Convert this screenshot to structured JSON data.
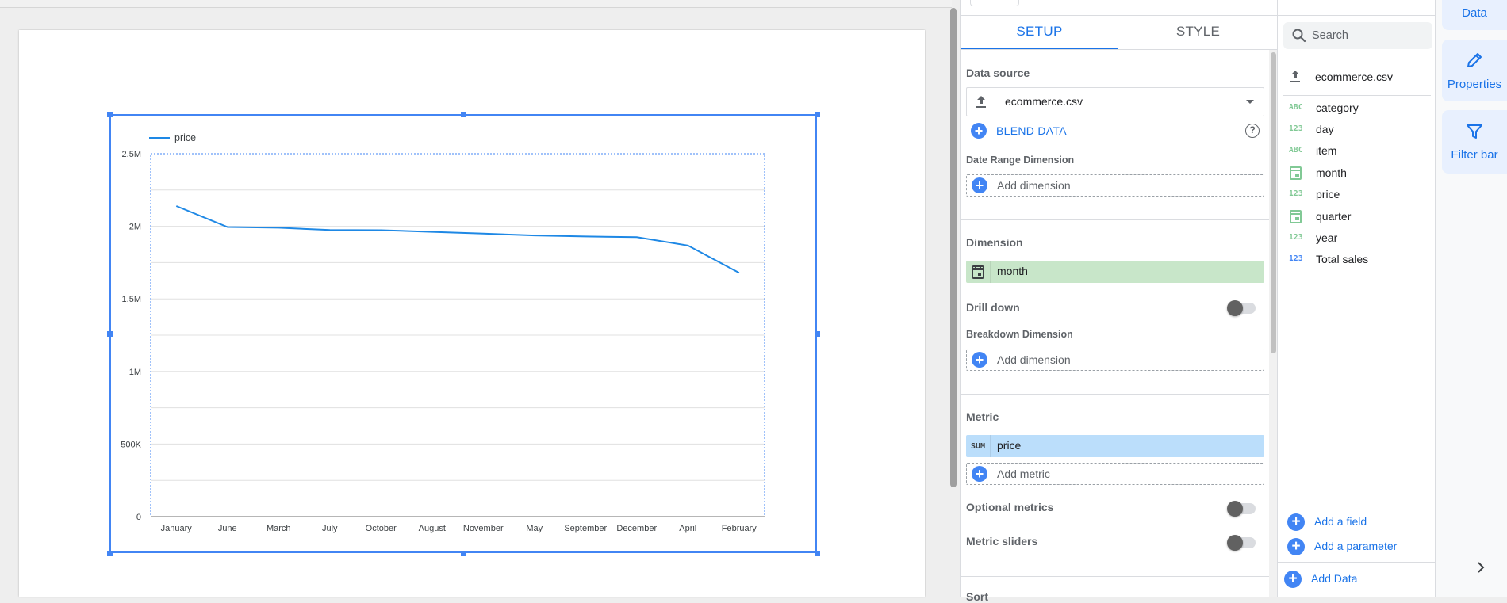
{
  "chart": {
    "legend": "price",
    "line_color": "#1e88e5",
    "chart_data": {
      "type": "line",
      "categories": [
        "January",
        "June",
        "March",
        "July",
        "October",
        "August",
        "November",
        "May",
        "September",
        "December",
        "April",
        "February"
      ],
      "series": [
        {
          "name": "price",
          "values": [
            2140000,
            1995000,
            1990000,
            1975000,
            1973000,
            1962000,
            1950000,
            1937000,
            1930000,
            1925000,
            1868000,
            1680000
          ]
        }
      ],
      "ylim": [
        0,
        2500000
      ],
      "yticks": [
        {
          "value": 2500000,
          "label": "2.5M"
        },
        {
          "value": 2000000,
          "label": "2M"
        },
        {
          "value": 1500000,
          "label": "1.5M"
        },
        {
          "value": 1000000,
          "label": "1M"
        },
        {
          "value": 500000,
          "label": "500K"
        },
        {
          "value": 0,
          "label": "0"
        }
      ],
      "grid": true,
      "legend_position": "top-left"
    }
  },
  "setup": {
    "tabs": {
      "setup": "SETUP",
      "style": "STYLE"
    },
    "data_source_label": "Data source",
    "data_source_value": "ecommerce.csv",
    "blend_data": "BLEND DATA",
    "help_glyph": "?",
    "date_range_label": "Date Range Dimension",
    "add_dimension": "Add dimension",
    "dimension_label": "Dimension",
    "dimension_value": "month",
    "drill_down": "Drill down",
    "breakdown_label": "Breakdown Dimension",
    "breakdown_add": "Add dimension",
    "metric_label": "Metric",
    "metric_agg": "SUM",
    "metric_value": "price",
    "add_metric": "Add metric",
    "optional_metrics": "Optional metrics",
    "metric_sliders": "Metric sliders",
    "cut_off_label": "Sort"
  },
  "data_panel": {
    "search_placeholder": "Search",
    "source_name": "ecommerce.csv",
    "fields": [
      {
        "type": "ABC",
        "name": "category",
        "color": "#81c995"
      },
      {
        "type": "123",
        "name": "day",
        "color": "#81c995"
      },
      {
        "type": "ABC",
        "name": "item",
        "color": "#81c995"
      },
      {
        "type": "date",
        "name": "month",
        "color": "#81c995"
      },
      {
        "type": "123",
        "name": "price",
        "color": "#81c995"
      },
      {
        "type": "date",
        "name": "quarter",
        "color": "#81c995"
      },
      {
        "type": "123",
        "name": "year",
        "color": "#81c995"
      },
      {
        "type": "123",
        "name": "Total sales",
        "color": "#4285f4"
      }
    ],
    "add_field": "Add a field",
    "add_parameter": "Add a parameter",
    "add_data": "Add Data"
  },
  "rail": {
    "data": "Data",
    "properties": "Properties",
    "filter_bar": "Filter bar"
  },
  "colors": {
    "accent": "#1a73e8",
    "dimension_chip": "#c8e6c9",
    "metric_chip": "#bbdefb"
  }
}
